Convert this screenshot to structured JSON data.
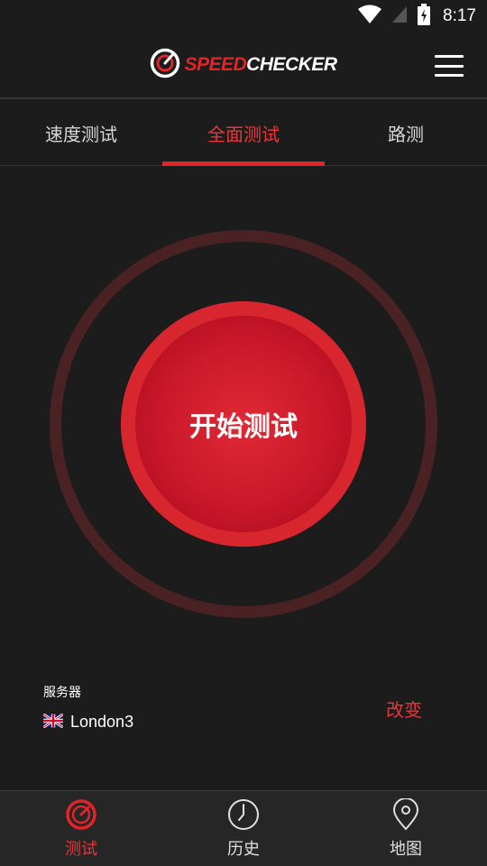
{
  "status_bar": {
    "time": "8:17",
    "icons": [
      "wifi-icon",
      "signal-icon",
      "battery-icon"
    ]
  },
  "header": {
    "logo_speed": "SPEED",
    "logo_checker": "CHECKER",
    "menu_icon": "hamburger-menu-icon"
  },
  "tabs": [
    {
      "label": "速度测试",
      "active": false
    },
    {
      "label": "全面测试",
      "active": true
    },
    {
      "label": "路测",
      "active": false
    }
  ],
  "main": {
    "start_label": "开始测试"
  },
  "server": {
    "caption": "服务器",
    "flag": "🇬🇧",
    "name": "London3",
    "change_label": "改变"
  },
  "bottom_nav": [
    {
      "label": "测试",
      "icon": "speedometer-icon",
      "active": true
    },
    {
      "label": "历史",
      "icon": "clock-icon",
      "active": false
    },
    {
      "label": "地图",
      "icon": "map-pin-icon",
      "active": false
    }
  ],
  "colors": {
    "accent": "#e02428",
    "background": "#1c1c1c",
    "ring": "#4a2224",
    "nav_background": "#262626"
  }
}
